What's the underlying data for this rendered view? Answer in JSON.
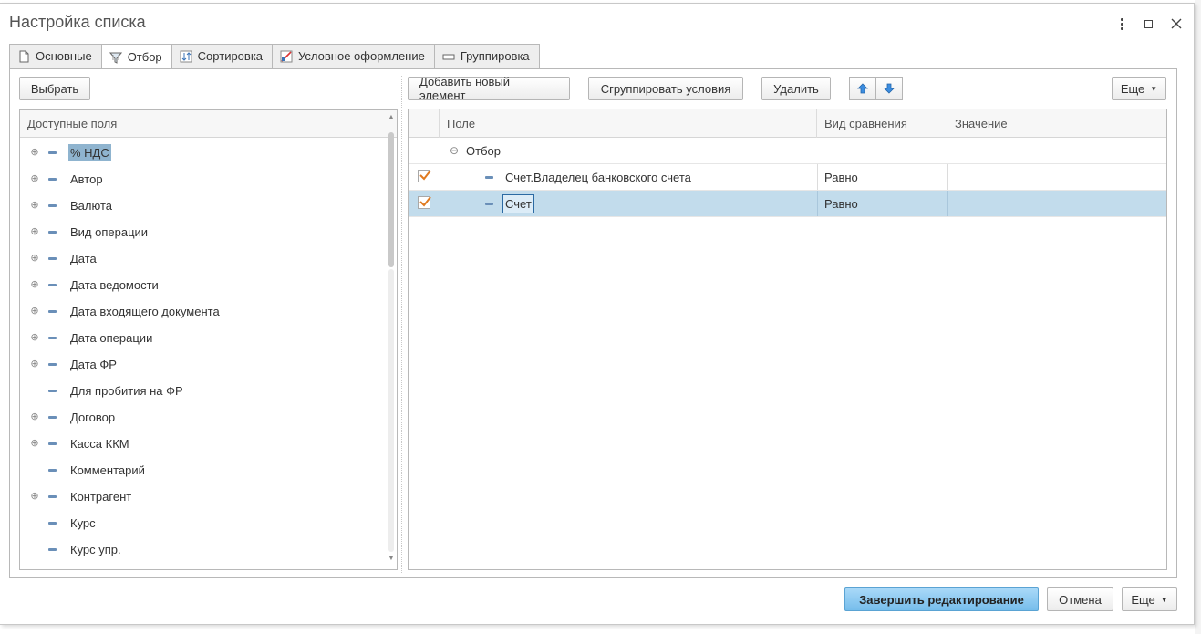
{
  "window": {
    "title": "Настройка списка"
  },
  "tabs": [
    {
      "label": "Основные",
      "icon": "document-icon"
    },
    {
      "label": "Отбор",
      "icon": "filter-icon",
      "active": true
    },
    {
      "label": "Сортировка",
      "icon": "sort-icon"
    },
    {
      "label": "Условное оформление",
      "icon": "conditional-format-icon"
    },
    {
      "label": "Группировка",
      "icon": "grouping-icon"
    }
  ],
  "left": {
    "select_button": "Выбрать",
    "tree_header": "Доступные поля",
    "fields": [
      {
        "label": "% НДС",
        "expandable": true,
        "selected": true
      },
      {
        "label": "Автор",
        "expandable": true
      },
      {
        "label": "Валюта",
        "expandable": true
      },
      {
        "label": "Вид операции",
        "expandable": true
      },
      {
        "label": "Дата",
        "expandable": true
      },
      {
        "label": "Дата ведомости",
        "expandable": true
      },
      {
        "label": "Дата входящего документа",
        "expandable": true
      },
      {
        "label": "Дата операции",
        "expandable": true
      },
      {
        "label": "Дата ФР",
        "expandable": true
      },
      {
        "label": "Для пробития на ФР",
        "expandable": false
      },
      {
        "label": "Договор",
        "expandable": true
      },
      {
        "label": "Касса ККМ",
        "expandable": true
      },
      {
        "label": "Комментарий",
        "expandable": false
      },
      {
        "label": "Контрагент",
        "expandable": true
      },
      {
        "label": "Курс",
        "expandable": false
      },
      {
        "label": "Курс упр.",
        "expandable": false
      }
    ]
  },
  "right": {
    "toolbar": {
      "add_button": "Добавить новый элемент",
      "group_button": "Сгруппировать условия",
      "delete_button": "Удалить",
      "more_button": "Еще"
    },
    "columns": {
      "field": "Поле",
      "comparison": "Вид сравнения",
      "value": "Значение"
    },
    "group_row": {
      "label": "Отбор"
    },
    "rows": [
      {
        "checked": true,
        "field": "Счет.Владелец банковского счета",
        "comparison": "Равно",
        "value": ""
      },
      {
        "checked": true,
        "field": "Счет",
        "comparison": "Равно",
        "value": "",
        "selected": true
      }
    ]
  },
  "footer": {
    "finish_button": "Завершить редактирование",
    "cancel_button": "Отмена",
    "more_button": "Еще"
  },
  "colors": {
    "primary_button": "#76bdeb",
    "selection": "#c2dcec",
    "checkmark": "#e07a1f"
  }
}
